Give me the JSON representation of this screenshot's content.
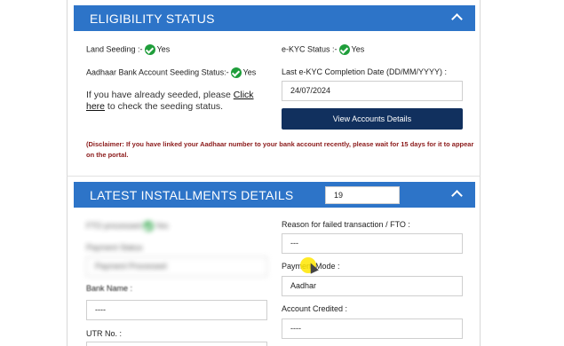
{
  "eligibility": {
    "title": "ELIGIBILITY STATUS",
    "land_seeding_label": "Land Seeding :-",
    "land_seeding_value": "Yes",
    "ekyc_label": "e-KYC Status :-",
    "ekyc_value": "Yes",
    "aadhaar_label": "Aadhaar Bank Account Seeding Status:-",
    "aadhaar_value": "Yes",
    "last_ekyc_label": "Last e-KYC Completion Date (DD/MM/YYYY) :",
    "last_ekyc_value": "24/07/2024",
    "info_prefix": "If you have already seeded, please ",
    "info_link": "Click here",
    "info_suffix": " to check the seeding status.",
    "view_button": "View Accounts Details",
    "disclaimer": "(Disclaimer: If you have linked your Aadhaar number to your bank account recently, please wait for 15 days for it to appear on the portal."
  },
  "installments": {
    "title": "LATEST INSTALLMENTS DETAILS",
    "installment_no": "19",
    "fto_processed_label": "FTO processed",
    "fto_processed_value": "Yes",
    "payment_status_label": "Payment Status",
    "payment_status_value": "Payment Processed",
    "reason_label": "Reason for failed transaction / FTO :",
    "reason_value": "---",
    "payment_mode_label": "Payment Mode :",
    "payment_mode_value": "Aadhar",
    "bank_name_label": "Bank Name :",
    "bank_name_value": "----",
    "account_credited_label": "Account Credited :",
    "account_credited_value": "----",
    "utr_label": "UTR No. :"
  },
  "colors": {
    "header_blue": "#2d74c8",
    "button_navy": "#11305e",
    "success_green": "#1f9e3b",
    "disclaimer_red": "#8b1a1a"
  },
  "icons": {
    "status_ok": "check-circle-icon",
    "collapse": "chevron-up-icon"
  }
}
